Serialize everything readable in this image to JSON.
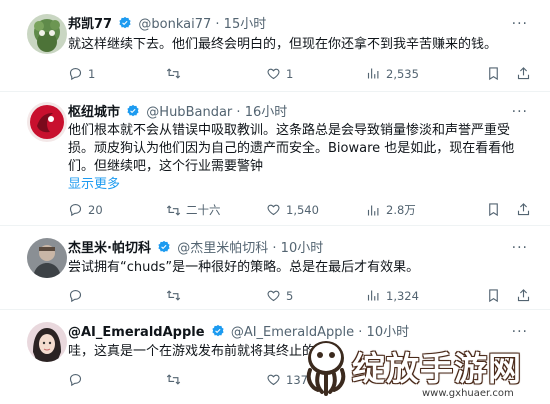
{
  "tweets": [
    {
      "name": "邦凯77",
      "handle": "@bonkai77",
      "time": "15小时",
      "text": "就这样继续下去。他们最终会明白的，但现在你还拿不到我辛苦赚来的钱。",
      "show_more": "",
      "replies": "1",
      "retweets": "",
      "likes": "1",
      "views": "2,535"
    },
    {
      "name": "枢纽城市",
      "handle": "@HubBandar",
      "time": "16小时",
      "text": "他们根本就不会从错误中吸取教训。这条路总是会导致销量惨淡和声誉严重受损。顽皮狗认为他们因为自己的遗产而安全。Bioware 也是如此，现在看看他们。但继续吧，这个行业需要警钟",
      "show_more": "显示更多",
      "replies": "20",
      "retweets": "二十六",
      "likes": "1,540",
      "views": "2.8万"
    },
    {
      "name": "杰里米·帕切科",
      "handle": "@杰里米帕切科",
      "time": "10小时",
      "text": "尝试拥有“chuds”是一种很好的策略。总是在最后才有效果。",
      "show_more": "",
      "replies": "",
      "retweets": "",
      "likes": "5",
      "views": "1,324"
    },
    {
      "name": "@AI_EmeraldApple",
      "handle": "@AI_EmeraldApple",
      "time": "10小时",
      "text": "哇，这真是一个在游戏发布前就将其终止的",
      "show_more": "",
      "replies": "",
      "retweets": "",
      "likes": "137",
      "views": ""
    }
  ],
  "separator": "·",
  "more_glyph": "···",
  "watermark": {
    "title": "绽放手游网",
    "url": "www.gxhuaer.com"
  },
  "colors": {
    "verified": "#1d9bf0",
    "muted": "#536471",
    "link": "#1d9bf0"
  }
}
